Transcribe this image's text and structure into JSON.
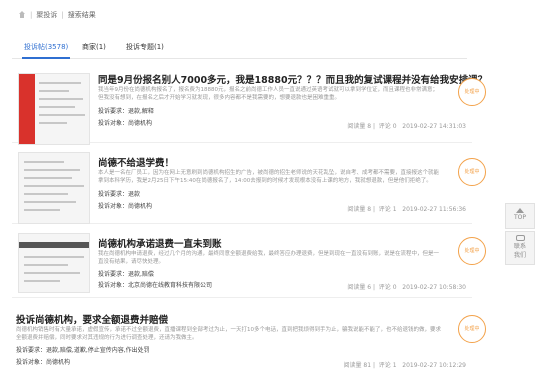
{
  "breadcrumb": {
    "first": "聚投诉",
    "second": "搜索结果"
  },
  "tabs": [
    "投诉帖(3578)",
    "商家(1)",
    "投诉专题(1)"
  ],
  "items": [
    {
      "title": "同是9月份报名别人7000多元，我是18880元？？？而且我的复试课程并没有给我安排课？",
      "summary": "我当年9月份在尚德机构报名了，报名费为18880元，报名之前尚德工作人员一直说通过英语考试就可以拿到学位证，而且课程也非常满意；但我没有想到，在报名之后才开始学习就发现，很多内容都不是我需要的，想要退款也是困难重重。",
      "requirement": "投诉要求：退款,解释",
      "target": "投诉对象：尚德机构",
      "views": "阅读量 8",
      "comments": "评论 0",
      "date": "2019-02-27 14:31:03",
      "stamp": "处理中"
    },
    {
      "title": "尚德不给退学费！",
      "summary": "本人是一名在厂员工，因为在网上无意刷到尚德机构招生的广告，被尚德的招生老师说的天花乱坠，说自考、成考都不需要，直接报这个就能拿到本科学历，我是2月25日下午15:40在尚德报名了，14:00去报到的时候才发现根本没有上课的地方，我就想退款，但是他们拒绝了。",
      "requirement": "投诉要求：退款",
      "target": "投诉对象：尚德机构",
      "views": "阅读量 8",
      "comments": "评论 1",
      "date": "2019-02-27 11:56:36",
      "stamp": "处理中"
    },
    {
      "title": "尚德机构承诺退费一直未到账",
      "summary": "我在尚德机构申请退费，经过几个月的沟通，最终同意全额退费给我，最终答应办理退费，但是到现在一直没有到账，说是在流程中，但是一直没有结果，请尽快处理。",
      "requirement": "投诉要求：退款,赔偿",
      "target": "投诉对象：北京尚德在线教育科技有限公司",
      "views": "阅读量 6",
      "comments": "评论 0",
      "date": "2019-02-27 10:58:30",
      "stamp": "处理中"
    },
    {
      "title": "投诉尚德机构，要求全额退费并赔偿",
      "summary": "尚德机构销售时有大量承诺，虚假宣传，承诺不过全额退费，直播课程到全部考过为止，一天打10多个电话，直到把我烦得到手为止，骗我说能不能了，也不给退钱的做，要求全额退费并赔偿，同时要求对其违规的行为进行调查处理，还请为我做主。",
      "requirement": "投诉要求：退款,赔偿,道歉,停止宣传内容,作出处罚",
      "target": "投诉对象：尚德机构",
      "views": "阅读量 81",
      "comments": "评论 1",
      "date": "2019-02-27 10:12:29",
      "stamp": "处理中"
    }
  ],
  "side": {
    "top": "TOP",
    "contact_1": "联系",
    "contact_2": "我们"
  }
}
